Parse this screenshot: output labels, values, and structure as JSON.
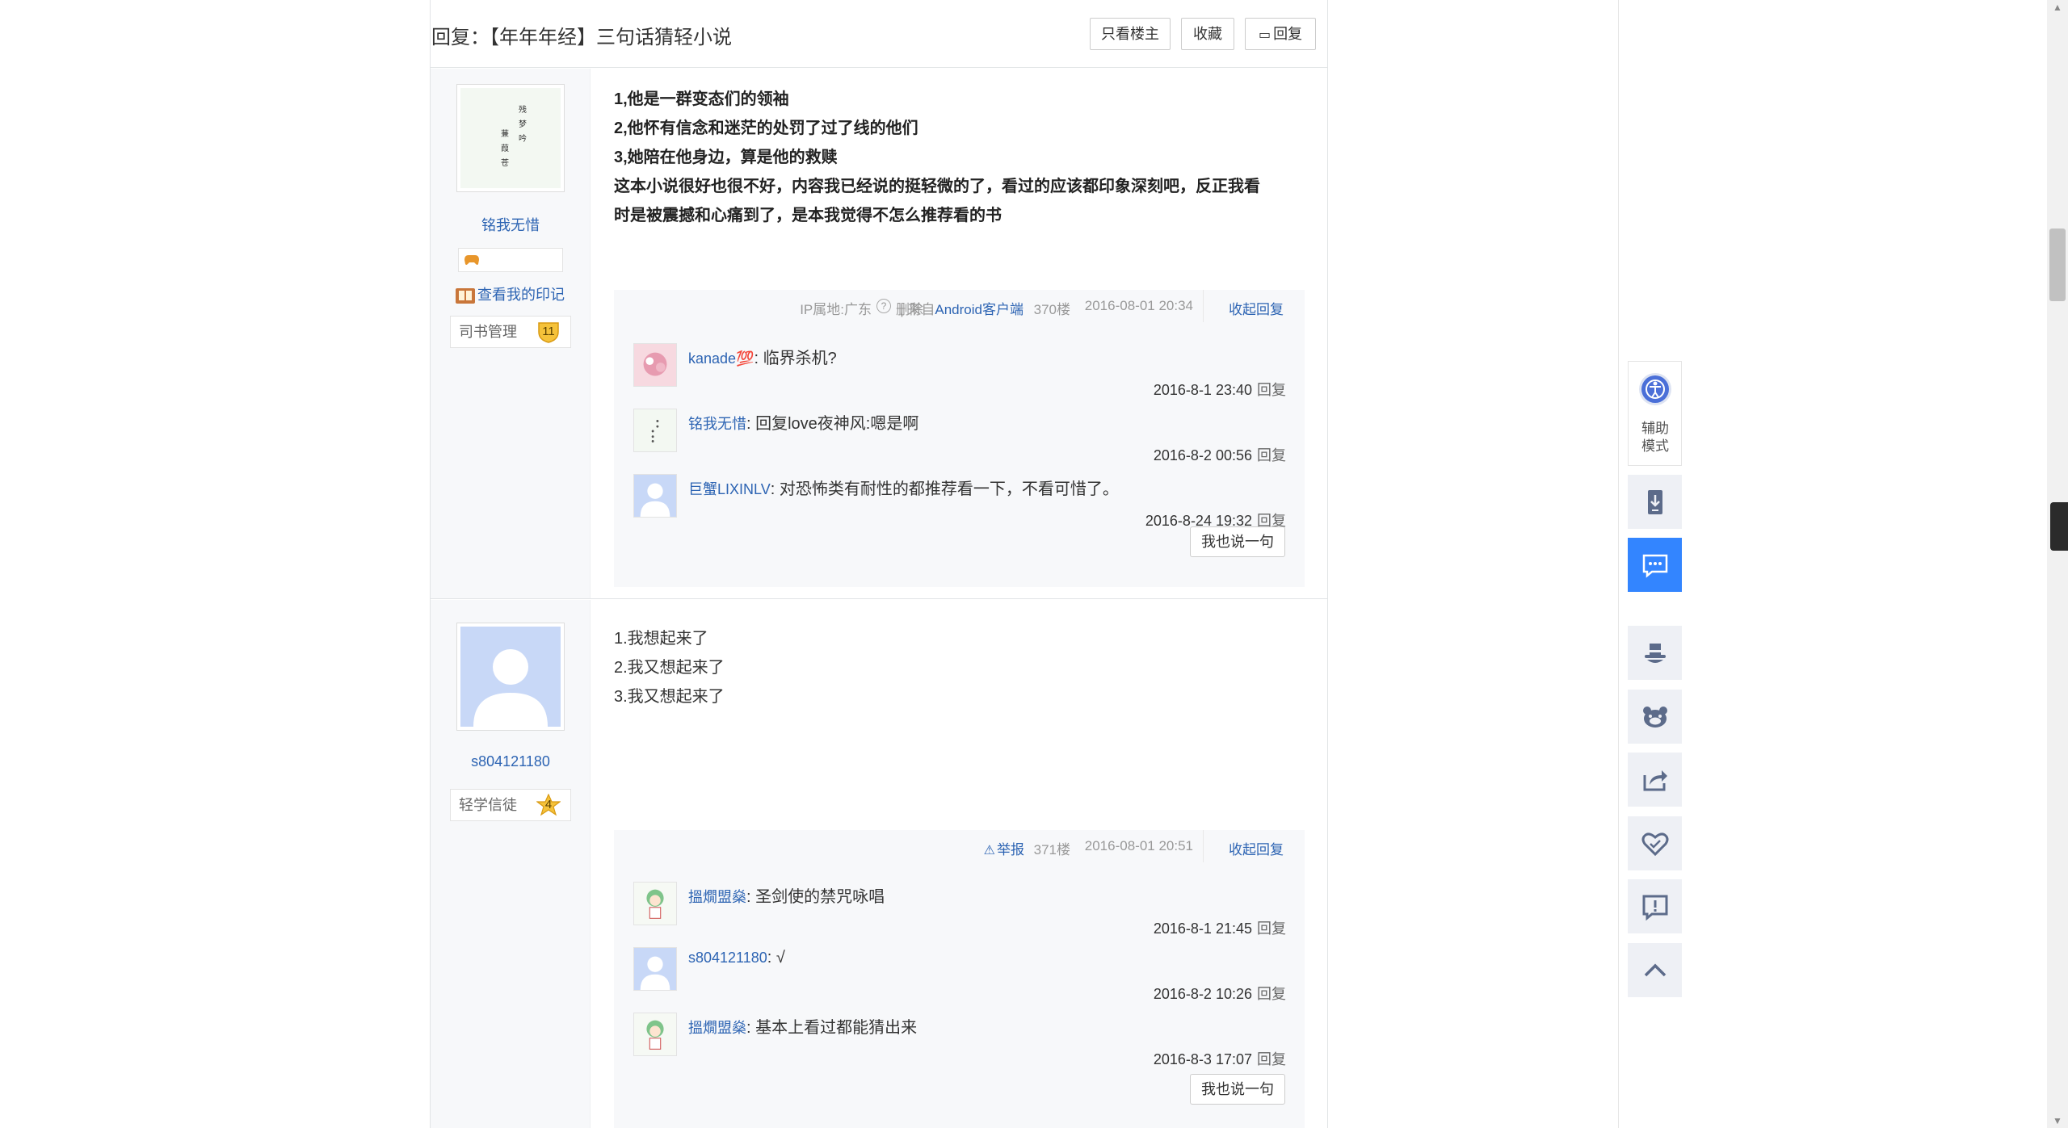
{
  "thread": {
    "title": "回复：【年年年经】三句话猜轻小说",
    "buttons": {
      "only_op": "只看楼主",
      "favorite": "收藏",
      "reply": "回复"
    }
  },
  "posts": [
    {
      "user": {
        "name": "铭我无惜",
        "avatar_text": "残 梦 吟 蒹 葭 苍",
        "mark_link": "查看我的印记",
        "level_title": "司书管理",
        "level": "11"
      },
      "lines": [
        "1,他是一群变态们的领袖",
        "2,他怀有信念和迷茫的处罚了过了线的他们",
        "3,她陪在他身边，算是他的救赎",
        "这本小说很好也很不好，内容我已经说的挺轻微的了，看过的应该都印象深刻吧，反正我看",
        "时是被震撼和心痛到了，是本我觉得不怎么推荐看的书"
      ],
      "meta": {
        "ip": "IP属地:广东",
        "delete": "删除",
        "from_prefix": "| 来自",
        "from": "Android客户端",
        "floor": "370楼",
        "time": "2016-08-01 20:34",
        "collapse": "收起回复"
      },
      "replies": [
        {
          "user": "kanade💯",
          "text": ": 临界杀机?",
          "time": "2016-8-1 23:40",
          "action": "回复"
        },
        {
          "user": "铭我无惜",
          "text": ": 回复love夜神风:嗯是啊",
          "time": "2016-8-2 00:56",
          "action": "回复"
        },
        {
          "user": "巨蟹LIXINLV",
          "text": ": 对恐怖类有耐性的都推荐看一下，不看可惜了。",
          "time": "2016-8-24 19:32",
          "action": "回复"
        }
      ],
      "say_button": "我也说一句"
    },
    {
      "user": {
        "name": "s804121180",
        "level_title": "轻学信徒",
        "level": "4"
      },
      "lines": [
        "1.我想起来了",
        "2.我又想起来了",
        "3.我又想起来了"
      ],
      "meta": {
        "report": "举报",
        "floor": "371楼",
        "time": "2016-08-01 20:51",
        "collapse": "收起回复"
      },
      "replies": [
        {
          "user": "搵燗盟燊",
          "text": ": 圣剑使的禁咒咏唱",
          "time": "2016-8-1 21:45",
          "action": "回复"
        },
        {
          "user": "s804121180",
          "text": ": √",
          "time": "2016-8-2 10:26",
          "action": "回复"
        },
        {
          "user": "搵燗盟燊",
          "text": ": 基本上看过都能猜出来",
          "time": "2016-8-3 17:07",
          "action": "回复"
        }
      ],
      "say_button": "我也说一句"
    }
  ],
  "toolbar": {
    "assist_label": "辅助模式",
    "accent": "#3385ff",
    "icons": [
      "accessibility-icon",
      "phone-download-icon",
      "message-icon",
      "magician-hat-icon",
      "bear-icon",
      "share-icon",
      "heart-icon",
      "report-icon",
      "back-to-top-icon"
    ]
  }
}
